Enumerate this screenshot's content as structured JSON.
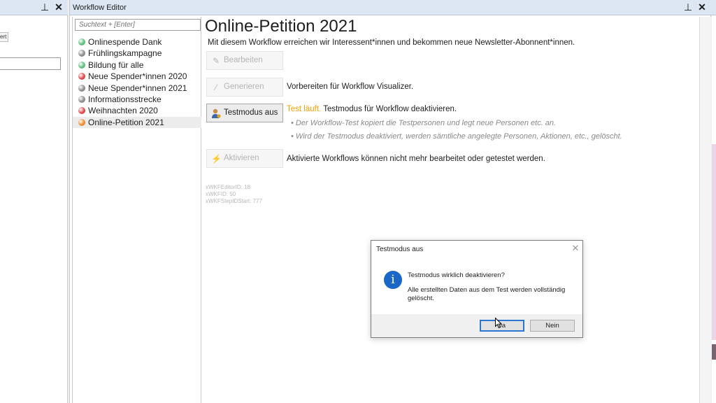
{
  "left_panel": {
    "tab_label": "ert"
  },
  "editor": {
    "window_title": "Workflow Editor",
    "search_placeholder": "Suchtext + [Enter]",
    "workflows": [
      {
        "label": "Onlinespende Dank",
        "status_color": "#5fbf7a"
      },
      {
        "label": "Frühlingskampagne",
        "status_color": "#8c8c8c"
      },
      {
        "label": "Bildung für alle",
        "status_color": "#5fbf7a"
      },
      {
        "label": "Neue Spender*innen 2020",
        "status_color": "#e04848"
      },
      {
        "label": "Neue Spender*innen 2021",
        "status_color": "#8c8c8c"
      },
      {
        "label": "Informationsstrecke",
        "status_color": "#8c8c8c"
      },
      {
        "label": "Weihnachten 2020",
        "status_color": "#e04848"
      },
      {
        "label": "Online-Petition 2021",
        "status_color": "#f08a30",
        "selected": true
      }
    ],
    "title": "Online-Petition 2021",
    "description": "Mit diesem Workflow erreichen wir Interessent*innen und bekommen neue Newsletter-Abonnent*innen.",
    "actions": {
      "edit": {
        "label": "Bearbeiten",
        "icon": "pencil-icon"
      },
      "generate": {
        "label": "Generieren",
        "icon": "wand-icon",
        "description": "Vorbereiten für Workflow Visualizer."
      },
      "testmode": {
        "label": "Testmodus aus",
        "icon": "user-test-icon",
        "status": "Test läuft.",
        "description": "Testmodus für Workflow deaktivieren.",
        "notes": [
          "Der Workflow-Test kopiert die Testpersonen und legt neue Personen etc. an.",
          "Wird der Testmodus deaktiviert, werden sämtliche angelegte Personen, Aktionen, etc., gelöscht."
        ]
      },
      "activate": {
        "label": "Aktivieren",
        "icon": "lightning-icon",
        "description": "Aktivierte Workflows können nicht mehr bearbeitet oder getestet werden."
      }
    },
    "debug": [
      "xWKFEditorID: 18",
      "xWKFID: 50",
      "xWKFStepIDStart: 777"
    ]
  },
  "dialog": {
    "title": "Testmodus aus",
    "question": "Testmodus wirklich deaktivieren?",
    "message": "Alle erstellten Daten aus dem Test werden vollständig gelöscht.",
    "yes_label": "Ja",
    "no_label": "Nein"
  }
}
